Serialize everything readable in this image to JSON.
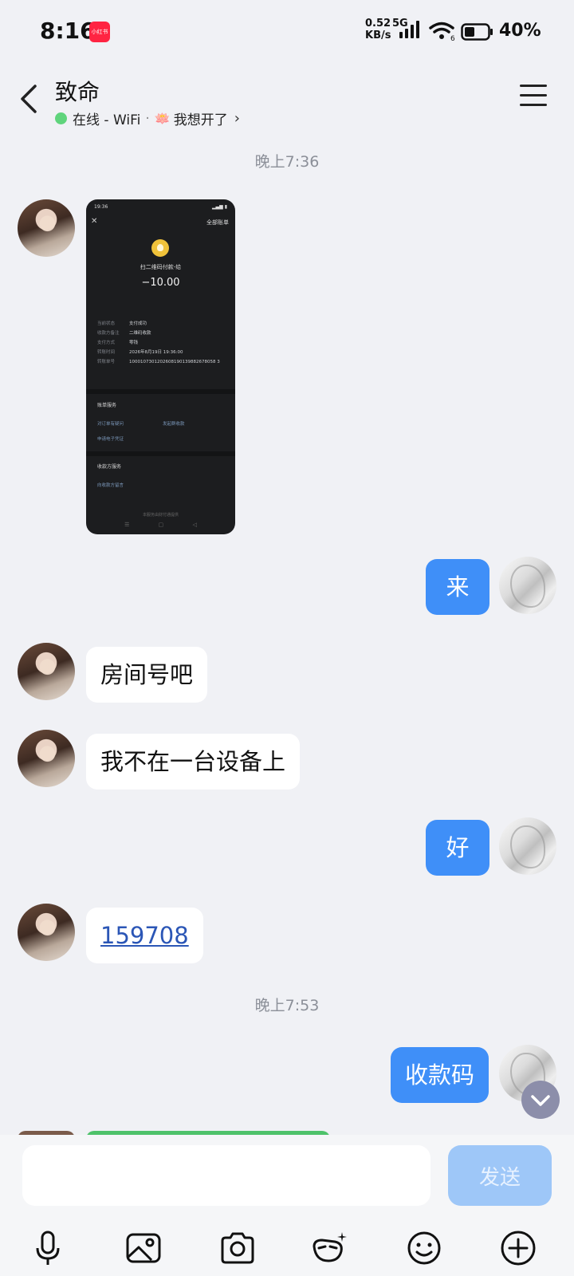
{
  "status_bar": {
    "time": "8:16",
    "app_badge": "小红书",
    "net_speed_value": "0.52",
    "net_speed_unit": "KB/s",
    "network_type": "5G",
    "wifi_sub": "6",
    "battery": "40%"
  },
  "header": {
    "contact_name": "致命",
    "presence": "在线 - WiFi",
    "separator": "·",
    "status_emoji": "🪷",
    "status_text": "我想开了"
  },
  "messages": {
    "timestamp_1": "晚上7:36",
    "image_message": {
      "status_time": "19:36",
      "all_bills": "全部账单",
      "merchant": "扫二维码付款-给",
      "amount": "−10.00",
      "rows": [
        {
          "k": "当前状态",
          "v": "支付成功"
        },
        {
          "k": "收款方备注",
          "v": "二维码收款"
        },
        {
          "k": "支付方式",
          "v": "零钱"
        },
        {
          "k": "转账时间",
          "v": "2026年8月19日 19:36:00"
        },
        {
          "k": "转账单号",
          "v": "1000107301202608190139882678058 3"
        }
      ],
      "section_bill_service": "账单服务",
      "link_1": "对订单有疑问",
      "link_2": "发起群收款",
      "link_3": "申请电子凭证",
      "section_payee_service": "收款方服务",
      "link_4": "向收款方留言",
      "footer": "本服务由财付通提供"
    },
    "msg_lai": "来",
    "msg_fangjianhao": "房间号吧",
    "msg_shebei": "我不在一台设备上",
    "msg_hao": "好",
    "msg_number": "159708",
    "timestamp_2": "晚上7:53",
    "msg_shoukuanma": "收款码"
  },
  "input": {
    "value": "",
    "send_label": "发送"
  },
  "toolbar_icons": [
    "microphone-icon",
    "image-icon",
    "camera-icon",
    "emoji-mask-icon",
    "smiley-icon",
    "plus-icon"
  ]
}
